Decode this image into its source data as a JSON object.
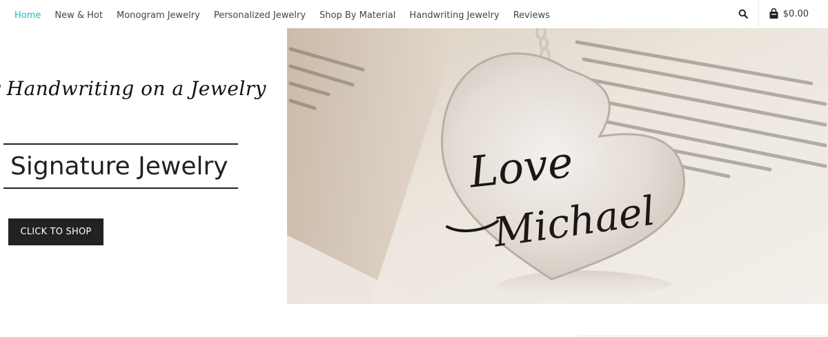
{
  "nav": {
    "items": [
      {
        "label": "Home",
        "active": true
      },
      {
        "label": "New & Hot",
        "active": false
      },
      {
        "label": "Monogram Jewelry",
        "active": false
      },
      {
        "label": "Personalized Jewelry",
        "active": false
      },
      {
        "label": "Shop By Material",
        "active": false
      },
      {
        "label": "Handwriting Jewelry",
        "active": false
      },
      {
        "label": "Reviews",
        "active": false
      }
    ],
    "search_icon": "search-icon",
    "cart_icon": "shopping-bag-icon",
    "cart_total": "$0.00"
  },
  "hero": {
    "tagline": "r Handwriting on a Jewelry",
    "title": "Signature Jewelry",
    "button_label": "CLICK TO SHOP",
    "image": {
      "description_icon": "heart-pendant-image",
      "engraving_line1": "Love",
      "engraving_line2": "Michael"
    }
  },
  "colors": {
    "accent": "#2ab3b3",
    "button_bg": "#222222",
    "text": "#444444"
  }
}
